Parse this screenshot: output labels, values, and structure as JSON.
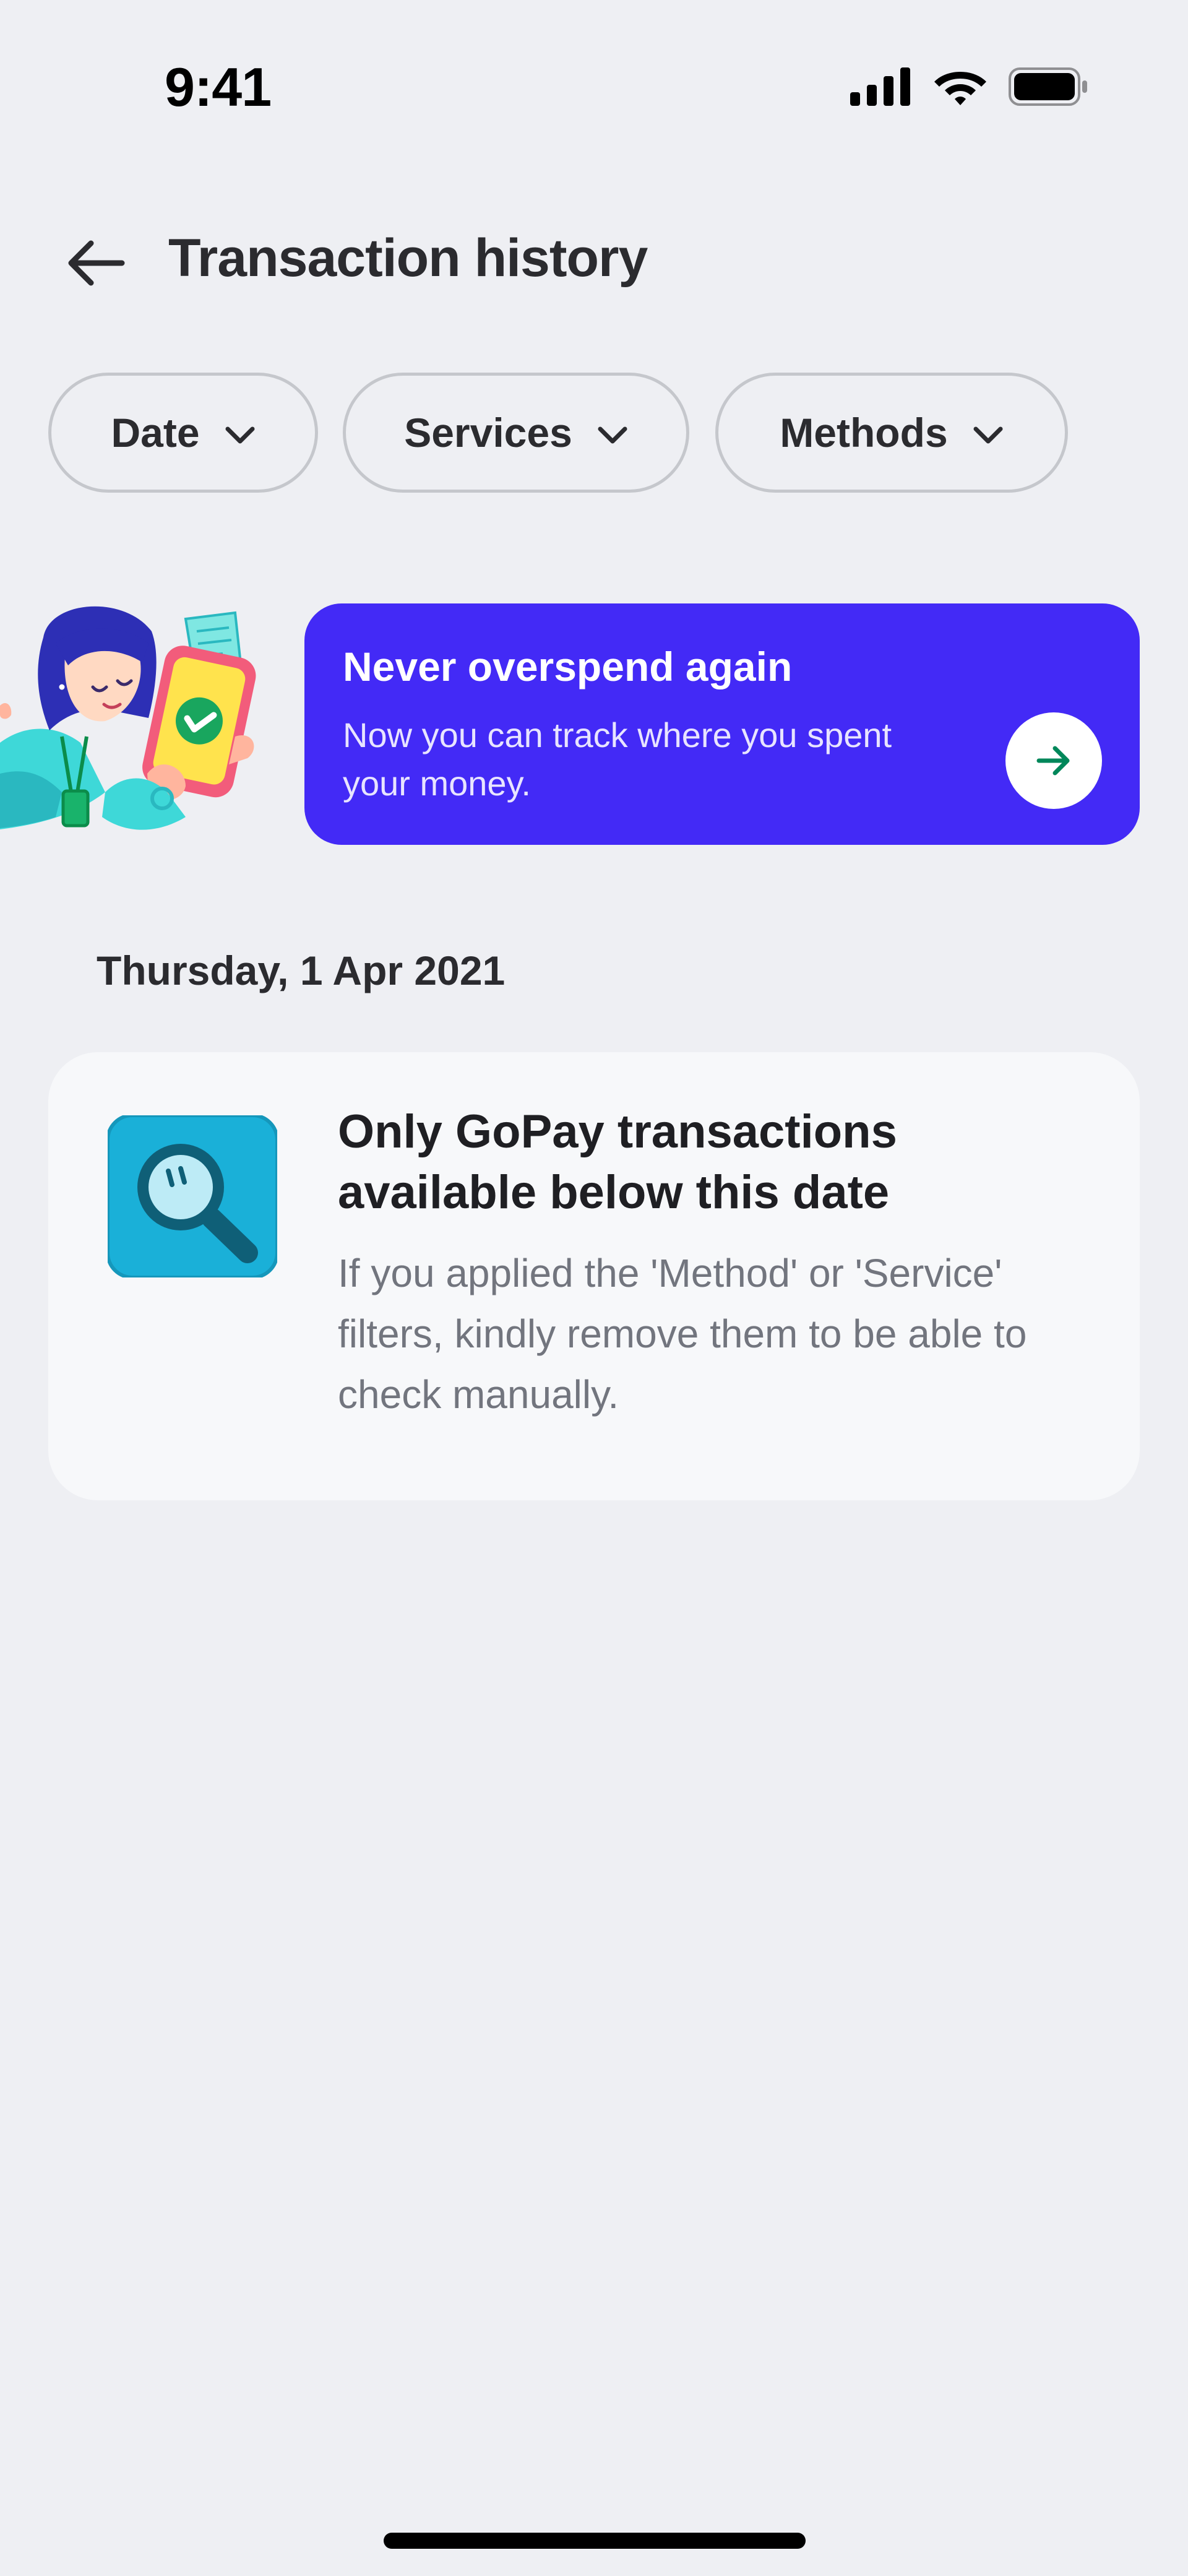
{
  "status_bar": {
    "time": "9:41"
  },
  "header": {
    "title": "Transaction history"
  },
  "filters": [
    {
      "label": "Date"
    },
    {
      "label": "Services"
    },
    {
      "label": "Methods"
    }
  ],
  "banner": {
    "title": "Never overspend again",
    "body": "Now you can track where you spent your money."
  },
  "date_header": "Thursday, 1 Apr 2021",
  "info_card": {
    "title": "Only GoPay transactions available below this date",
    "body": "If you applied the 'Method' or 'Service' filters, kindly remove them to be able to check manually."
  },
  "colors": {
    "background": "#EEEFF3",
    "banner": "#432AF6",
    "card": "#F7F8FA",
    "accent_green": "#00AA5B",
    "icon_blue": "#1AB0D8"
  }
}
